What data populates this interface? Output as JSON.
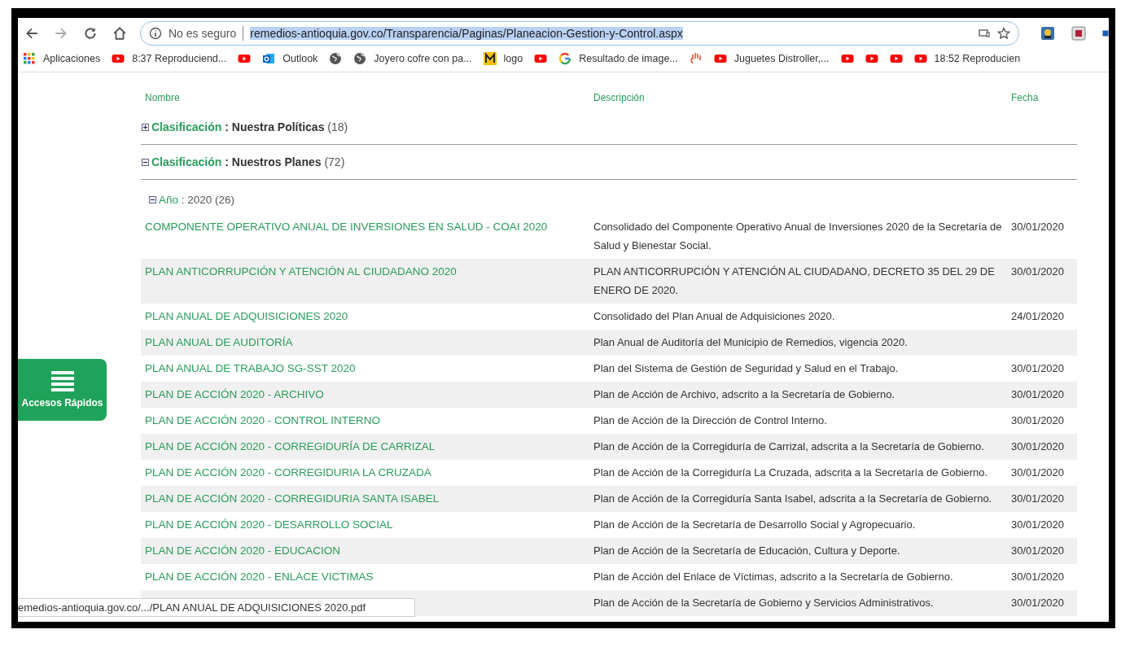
{
  "browser": {
    "security": "No es seguro",
    "url": "remedios-antioquia.gov.co/Transparencia/Paginas/Planeacion-Gestion-y-Control.aspx"
  },
  "bookmarks": [
    {
      "kind": "apps",
      "label": "Aplicaciones"
    },
    {
      "kind": "youtube",
      "label": "8:37 Reproduciend..."
    },
    {
      "kind": "youtube"
    },
    {
      "kind": "outlook",
      "label": "Outlook"
    },
    {
      "kind": "globe"
    },
    {
      "kind": "globe",
      "label": "Joyero cofre con pa..."
    },
    {
      "kind": "m",
      "label": "logo"
    },
    {
      "kind": "youtube"
    },
    {
      "kind": "google",
      "label": "Resultado de image..."
    },
    {
      "kind": "hand"
    },
    {
      "kind": "youtube",
      "label": "Juguetes Distroller,..."
    },
    {
      "kind": "youtube"
    },
    {
      "kind": "youtube"
    },
    {
      "kind": "youtube"
    },
    {
      "kind": "youtube",
      "label": "18:52 Reproducien"
    }
  ],
  "table": {
    "columns": [
      "Nombre",
      "Descripción",
      "Fecha"
    ],
    "groups": [
      {
        "label": "Clasificación",
        "value": ": Nuestra Políticas",
        "count": "(18)",
        "expanded": false
      },
      {
        "label": "Clasificación",
        "value": ": Nuestros Planes",
        "count": "(72)",
        "expanded": true,
        "subgroups": [
          {
            "label": "Año",
            "value": ": 2020",
            "count": "(26)",
            "expanded": true,
            "rows": [
              {
                "name": "COMPONENTE OPERATIVO ANUAL DE INVERSIONES EN SALUD - COAI 2020",
                "description": "Consolidado del Componente Operativo Anual de Inversiones 2020 de la Secretaría de Salud y Bienestar Social.",
                "date": "30/01/2020"
              },
              {
                "name": "PLAN ANTICORRUPCIÓN Y ATENCIÓN AL CIUDADANO 2020",
                "description": "PLAN ANTICORRUPCIÓN Y ATENCIÓN AL CIUDADANO, DECRETO 35 DEL 29 DE ENERO DE 2020.",
                "date": "30/01/2020"
              },
              {
                "name": "PLAN ANUAL DE ADQUISICIONES 2020",
                "description": "Consolidado del Plan Anual de Adquisiciones 2020.",
                "date": "24/01/2020"
              },
              {
                "name": "PLAN ANUAL DE AUDITORÍA",
                "description": "Plan Anual de Auditoría del Municipio de Remedios, vigencia 2020."
              },
              {
                "name": "PLAN ANUAL DE TRABAJO SG-SST 2020",
                "description": "Plan del Sistema de Gestión de Seguridad y Salud en el Trabajo.",
                "date": "30/01/2020"
              },
              {
                "name": "PLAN DE ACCIÓN 2020 - ARCHIVO",
                "description": "Plan de Acción de Archivo, adscrito a la Secretaría de Gobierno.",
                "date": "30/01/2020"
              },
              {
                "name": "PLAN DE ACCIÓN 2020 - CONTROL INTERNO",
                "description": "Plan de Acción de la Dirección de Control Interno.",
                "date": "30/01/2020"
              },
              {
                "name": "PLAN DE ACCIÓN 2020 - CORREGIDURÍA DE CARRIZAL",
                "description": "Plan de Acción de la Corregiduría de Carrizal, adscrita a la Secretaría de Gobierno.",
                "date": "30/01/2020"
              },
              {
                "name": "PLAN DE ACCIÓN 2020 - CORREGIDURIA LA CRUZADA",
                "description": "Plan de Acción de la Corregiduría La Cruzada, adscrita a la Secretaría de Gobierno.",
                "date": "30/01/2020"
              },
              {
                "name": "PLAN DE ACCIÓN 2020 - CORREGIDURIA SANTA ISABEL",
                "description": "Plan de Acción de la Corregiduría Santa Isabel, adscrita a la Secretaría de Gobierno.",
                "date": "30/01/2020"
              },
              {
                "name": "PLAN DE ACCIÓN 2020 - DESARROLLO SOCIAL",
                "description": "Plan de Acción de la Secretaría de Desarrollo Social y Agropecuario.",
                "date": "30/01/2020"
              },
              {
                "name": "PLAN DE ACCIÓN 2020 - EDUCACION",
                "description": "Plan de Acción de la Secretaría de Educación, Cultura y Deporte.",
                "date": "30/01/2020"
              },
              {
                "name": "PLAN DE ACCIÓN 2020 - ENLACE VICTIMAS",
                "description": "Plan de Acción del Enlace de Víctimas, adscrito a la Secretaría de Gobierno.",
                "date": "30/01/2020"
              },
              {
                "description": "Plan de Acción de la Secretaría de Gobierno y Servicios Administrativos.",
                "date": "30/01/2020"
              }
            ]
          }
        ]
      }
    ]
  },
  "quick_access": {
    "label": "Accesos Rápidos"
  },
  "status_url": "emedios-antioquia.gov.co/.../PLAN ANUAL DE ADQUISICIONES 2020.pdf"
}
